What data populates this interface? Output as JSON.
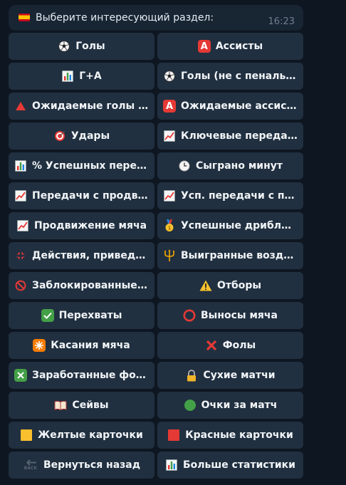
{
  "message": {
    "text": "Выберите интересующий раздел:",
    "time": "16:23",
    "flag_icon": "spain-flag-icon"
  },
  "buttons": [
    {
      "label": "Голы",
      "icon": "soccer-ball-icon"
    },
    {
      "label": "Ассисты",
      "icon": "letter-a-icon"
    },
    {
      "label": "Г+А",
      "icon": "bar-chart-icon"
    },
    {
      "label": "Голы (не с пенальти)",
      "icon": "soccer-ball-icon"
    },
    {
      "label": "Ожидаемые голы (xG)",
      "icon": "red-triangle-up-icon"
    },
    {
      "label": "Ожидаемые ассисты...",
      "icon": "letter-a-icon"
    },
    {
      "label": "Удары",
      "icon": "target-icon"
    },
    {
      "label": "Ключевые передачи",
      "icon": "trend-up-chart-icon"
    },
    {
      "label": "% Успешных передач",
      "icon": "bar-chart-icon"
    },
    {
      "label": "Сыграно минут",
      "icon": "clock-icon"
    },
    {
      "label": "Передачи с продви...",
      "icon": "trend-up-chart-icon"
    },
    {
      "label": "Усп. передачи с про...",
      "icon": "trend-up-chart-icon"
    },
    {
      "label": "Продвижение мяча",
      "icon": "trend-up-chart-icon"
    },
    {
      "label": "Успешные дриблинги",
      "icon": "medal-icon"
    },
    {
      "label": "Действия, приведш...",
      "icon": "anger-symbol-icon"
    },
    {
      "label": "Выигранные возду...",
      "icon": "trident-icon"
    },
    {
      "label": "Заблокированные у...",
      "icon": "prohibited-icon"
    },
    {
      "label": "Отборы",
      "icon": "warning-icon"
    },
    {
      "label": "Перехваты",
      "icon": "check-mark-button-icon"
    },
    {
      "label": "Выносы мяча",
      "icon": "red-circle-ring-icon"
    },
    {
      "label": "Касания мяча",
      "icon": "eight-pointed-star-icon"
    },
    {
      "label": "Фолы",
      "icon": "cross-mark-icon"
    },
    {
      "label": "Заработанные фолы",
      "icon": "cross-mark-button-icon"
    },
    {
      "label": "Сухие матчи",
      "icon": "lock-icon"
    },
    {
      "label": "Сейвы",
      "icon": "open-book-icon"
    },
    {
      "label": "Очки за матч",
      "icon": "green-circle-icon"
    },
    {
      "label": "Желтые карточки",
      "icon": "yellow-square-icon"
    },
    {
      "label": "Красные карточки",
      "icon": "red-square-icon"
    },
    {
      "label": "Вернуться назад",
      "icon": "back-arrow-icon",
      "icon_text": "BACK"
    },
    {
      "label": "Больше статистики",
      "icon": "bar-chart-icon"
    }
  ]
}
